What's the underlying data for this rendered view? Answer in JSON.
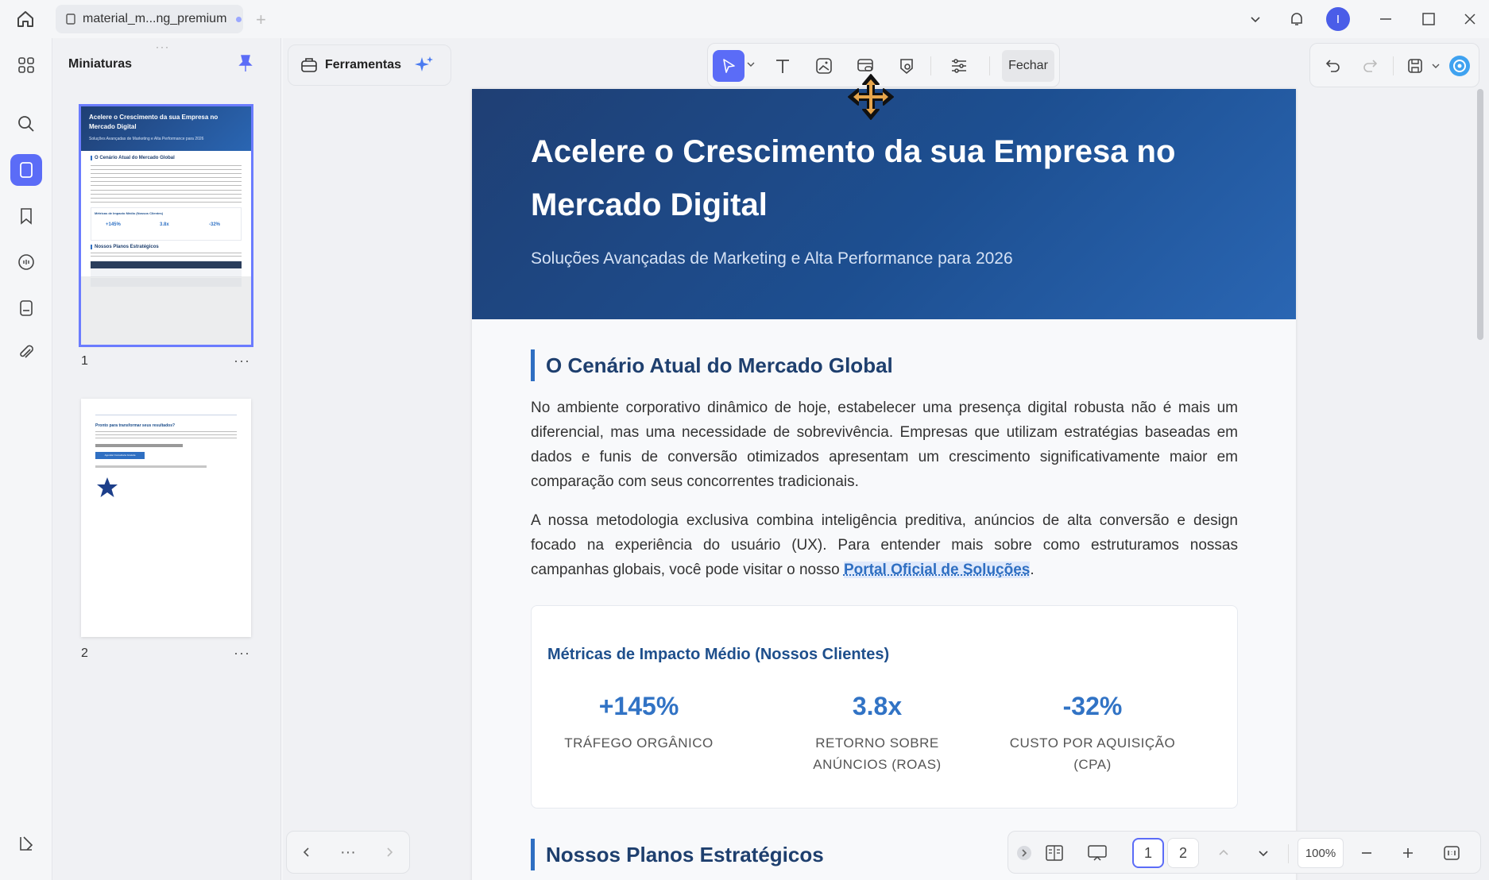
{
  "titlebar": {
    "tab_title": "material_m...ng_premium",
    "avatar_initial": "I"
  },
  "thumbnails": {
    "title": "Miniaturas",
    "pages": [
      {
        "number": "1",
        "more": "···"
      },
      {
        "number": "2",
        "more": "···"
      }
    ]
  },
  "toolbar": {
    "tools_label": "Ferramentas",
    "close_label": "Fechar"
  },
  "document": {
    "title": "Acelere o Crescimento da sua Empresa no Mercado Digital",
    "subtitle": "Soluções Avançadas de Marketing e Alta Performance para 2026",
    "section1_title": "O Cenário Atual do Mercado Global",
    "para1": "No ambiente corporativo dinâmico de hoje, estabelecer uma presença digital robusta não é mais um diferencial, mas uma necessidade de sobrevivência. Empresas que utilizam estratégias baseadas em dados e funis de conversão otimizados apresentam um crescimento significativamente maior em comparação com seus concorrentes tradicionais.",
    "para2_before": "A nossa metodologia exclusiva combina inteligência preditiva, anúncios de alta conversão e design focado na experiência do usuário (UX). Para entender mais sobre como estruturamos nossas campanhas globais, você pode visitar o nosso ",
    "para2_link": "Portal Oficial de Soluções",
    "para2_after": ".",
    "metrics_title": "Métricas de Impacto Médio (Nossos Clientes)",
    "metrics": [
      {
        "value": "+145%",
        "label": "TRÁFEGO ORGÂNICO"
      },
      {
        "value": "3.8x",
        "label": "RETORNO SOBRE ANÚNCIOS (ROAS)"
      },
      {
        "value": "-32%",
        "label": "CUSTO POR AQUISIÇÃO (CPA)"
      }
    ],
    "section2_title": "Nossos Planos Estratégicos"
  },
  "thumb1": {
    "title": "Acelere o Crescimento da sua Empresa no Mercado Digital",
    "subtitle": "Soluções Avançadas de Marketing e Alta Performance para 2026",
    "section": "O Cenário Atual do Mercado Global",
    "metrics_title": "Métricas de Impacto Médio (Nossos Clientes)",
    "m1": "+145%",
    "m2": "3.8x",
    "m3": "-32%",
    "plans": "Nossos Planos Estratégicos"
  },
  "thumb2": {
    "heading": "Pronto para transformar seus resultados?",
    "cta": "Agendar Consultoria Gratuita"
  },
  "pager": {
    "more": "···",
    "page1": "1",
    "page2": "2",
    "zoom": "100%"
  },
  "colors": {
    "accent": "#5b6cf7",
    "hero_dark": "#1f3f74",
    "hero_light": "#2a66b3",
    "heading": "#1e3f6e",
    "metric_value": "#3173c5"
  }
}
